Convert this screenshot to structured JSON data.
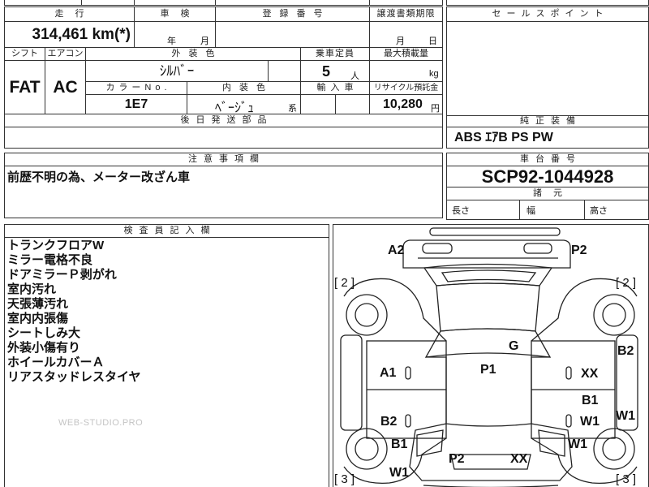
{
  "mileage": {
    "label": "走行",
    "value": "314,461 km(*)"
  },
  "inspection": {
    "label": "車検",
    "year_unit": "年",
    "month_unit": "月"
  },
  "registration_number": {
    "label": "登録番号"
  },
  "transfer_docs_deadline": {
    "label": "譲渡書類期限",
    "month_unit": "月",
    "day_unit": "日"
  },
  "shift": {
    "label": "シフト",
    "value": "FAT"
  },
  "air_conditioner": {
    "label": "エアコン",
    "value": "AC"
  },
  "exterior_color": {
    "label": "外装色",
    "value": "ｼﾙﾊﾞｰ"
  },
  "seating_capacity": {
    "label": "乗車定員",
    "value": "5",
    "unit": "人"
  },
  "max_load": {
    "label": "最大積載量",
    "unit": "kg"
  },
  "color_code": {
    "label": "カラーNo.",
    "value": "1E7"
  },
  "interior_color": {
    "label": "内装色",
    "value": "ﾍﾞｰｼﾞｭ",
    "suffix": "系"
  },
  "imported_car": {
    "label": "輸入車"
  },
  "recycling_deposit": {
    "label": "リサイクル預託金",
    "value": "10,280",
    "unit": "円"
  },
  "parts_sent_later": {
    "label": "後日発送部品"
  },
  "sales_points": {
    "label": "セールスポイント"
  },
  "genuine_equipment": {
    "label": "純正装備",
    "value": "ABS ｴｱB PS PW"
  },
  "caution_notes": {
    "label": "注意事項欄",
    "value": "前歴不明の為、メーター改ざん車"
  },
  "chassis_number": {
    "label": "車台番号",
    "value": "SCP92-1044928"
  },
  "specifications": {
    "label": "諸元",
    "length_label": "長さ",
    "width_label": "幅",
    "height_label": "高さ"
  },
  "inspector_notes": {
    "label": "検査員記入欄",
    "items": [
      "トランクフロアW",
      "ミラー電格不良",
      "ドアミラーＰ剥がれ",
      "室内汚れ",
      "天張薄汚れ",
      "室内内張傷",
      "シートしみ大",
      "外装小傷有り",
      "ホイールカバーＡ",
      "リアスタッドレスタイヤ"
    ]
  },
  "damage_map": {
    "marks": [
      "A2",
      "P2",
      "B2",
      "G",
      "P1",
      "A1",
      "XX",
      "B1",
      "B2",
      "W1",
      "W1",
      "B1",
      "W1",
      "P2",
      "XX",
      "W1"
    ],
    "panel_counts": [
      "[ 2 ]",
      "[ 2 ]",
      "[ 3 ]",
      "[ 3 ]"
    ]
  },
  "watermark": "WEB-STUDIO.PRO"
}
